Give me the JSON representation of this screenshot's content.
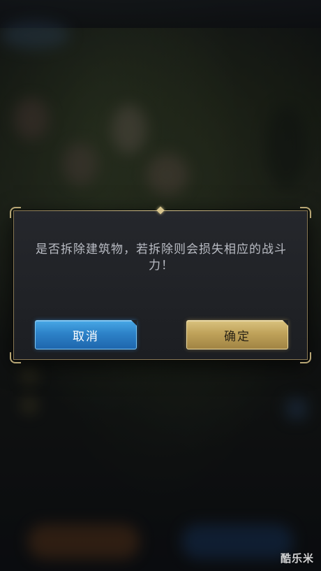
{
  "dialog": {
    "message": "是否拆除建筑物，若拆除则会损失相应的战斗力！",
    "cancel_label": "取消",
    "confirm_label": "确定"
  },
  "watermark": "酷乐米",
  "colors": {
    "cancel_button": "#2d82c8",
    "confirm_button": "#bfa25a",
    "dialog_border": "#8a7a55"
  }
}
